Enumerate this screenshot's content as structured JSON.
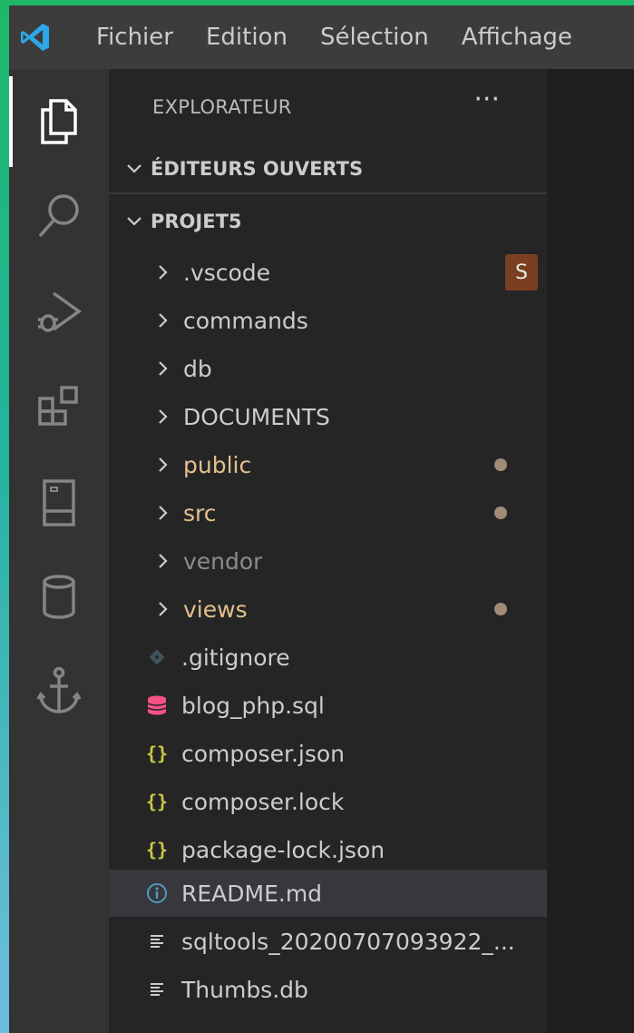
{
  "menu": {
    "items": [
      "Fichier",
      "Edition",
      "Sélection",
      "Affichage"
    ]
  },
  "activity_bar": {
    "icons": [
      "explorer-icon",
      "search-icon",
      "run-debug-icon",
      "extensions-icon",
      "remote-explorer-icon",
      "database-icon",
      "anchor-icon"
    ]
  },
  "sidebar": {
    "title": "EXPLORATEUR",
    "more_actions": "···",
    "open_editors": {
      "label": "ÉDITEURS OUVERTS"
    },
    "project": {
      "label": "PROJET5",
      "folders": [
        {
          "label": ".vscode",
          "color": "#cccccc",
          "badge": "S"
        },
        {
          "label": "commands",
          "color": "#cccccc"
        },
        {
          "label": "db",
          "color": "#cccccc"
        },
        {
          "label": "DOCUMENTS",
          "color": "#cccccc"
        },
        {
          "label": "public",
          "color": "#e2c08d",
          "modified": true
        },
        {
          "label": "src",
          "color": "#e2c08d",
          "modified": true
        },
        {
          "label": "vendor",
          "color": "#8c8c8c"
        },
        {
          "label": "views",
          "color": "#e2c08d",
          "modified": true
        }
      ],
      "files": [
        {
          "label": ".gitignore",
          "icon": "git-icon"
        },
        {
          "label": "blog_php.sql",
          "icon": "database-file-icon"
        },
        {
          "label": "composer.json",
          "icon": "json-icon"
        },
        {
          "label": "composer.lock",
          "icon": "json-icon"
        },
        {
          "label": "package-lock.json",
          "icon": "json-icon"
        },
        {
          "label": "README.md",
          "icon": "info-icon",
          "selected": true
        },
        {
          "label": "sqltools_20200707093922_...",
          "icon": "text-file-icon"
        },
        {
          "label": "Thumbs.db",
          "icon": "text-file-icon"
        }
      ]
    }
  },
  "colors": {
    "accent": "#007acc",
    "modified_dot": "#a08b74",
    "badge_bg": "#7a3f1f"
  }
}
